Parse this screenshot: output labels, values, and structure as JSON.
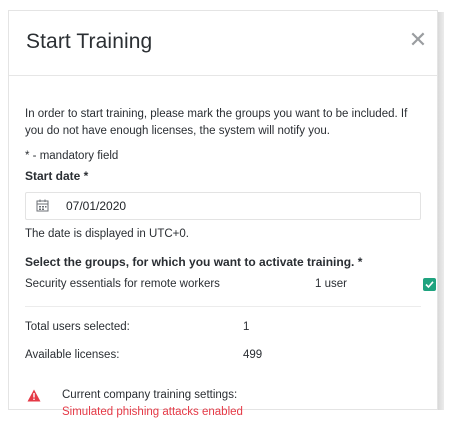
{
  "dialog": {
    "title": "Start Training",
    "close_icon": "close-icon"
  },
  "intro_text": "In order to start training, please mark the groups you want to be included. If you do not have enough licenses, the system will notify you.",
  "mandatory_note": "* - mandatory field",
  "start_date": {
    "label": "Start date *",
    "icon": "calendar-icon",
    "value": "07/01/2020",
    "hint": "The date is displayed in UTC+0."
  },
  "groups": {
    "label": "Select the groups, for which you want to activate training. *",
    "items": [
      {
        "name": "Security essentials for remote workers",
        "count": "1 user",
        "checked": true
      }
    ]
  },
  "stats": {
    "total_users_label": "Total users selected:",
    "total_users_value": "1",
    "licenses_label": "Available licenses:",
    "licenses_value": "499"
  },
  "warning": {
    "icon": "warning-icon",
    "line1": "Current company training settings:",
    "line2": "Simulated phishing attacks enabled",
    "color": "#e53946"
  },
  "colors": {
    "accent_check": "#1fa37f",
    "warning_red": "#e53946"
  }
}
